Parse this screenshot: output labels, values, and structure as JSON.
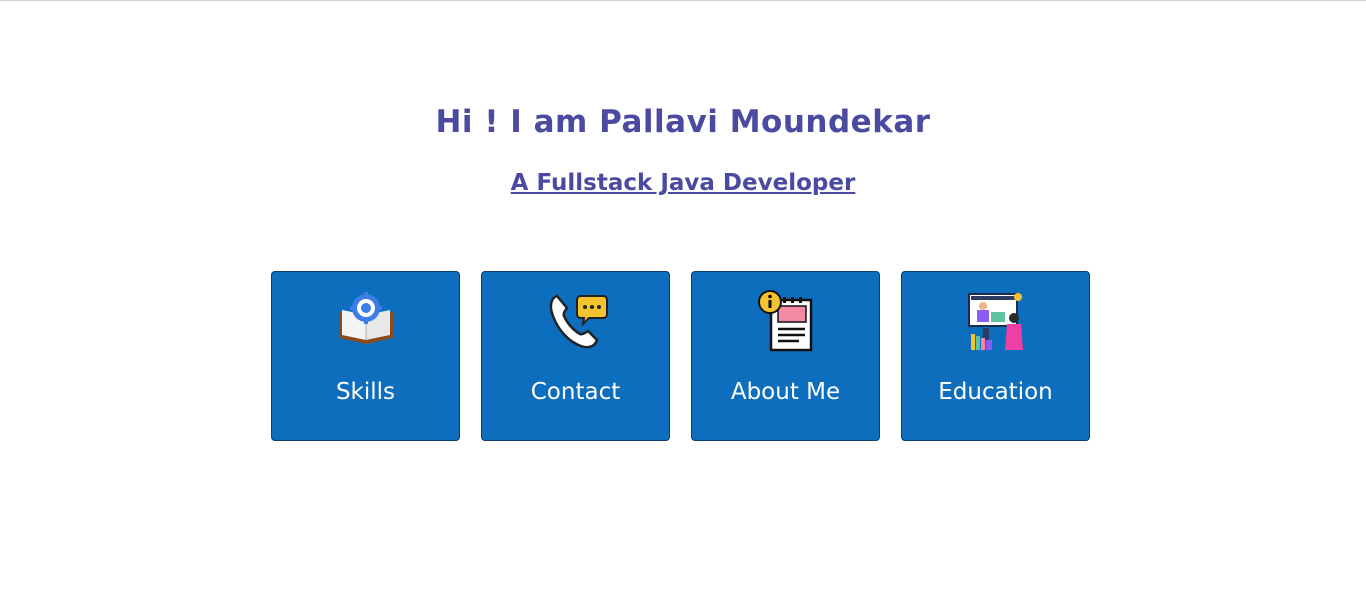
{
  "hero": {
    "headline": "Hi ! I am Pallavi Moundekar",
    "subtitle": "A Fullstack Java Developer"
  },
  "cards": [
    {
      "label": "Skills",
      "icon": "book-gear-icon"
    },
    {
      "label": "Contact",
      "icon": "phone-chat-icon"
    },
    {
      "label": "About Me",
      "icon": "info-clipboard-icon"
    },
    {
      "label": "Education",
      "icon": "teacher-board-icon"
    }
  ],
  "colors": {
    "heading": "#4a4ba0",
    "card_bg": "#0d6ebd",
    "card_text": "#ffffff"
  }
}
